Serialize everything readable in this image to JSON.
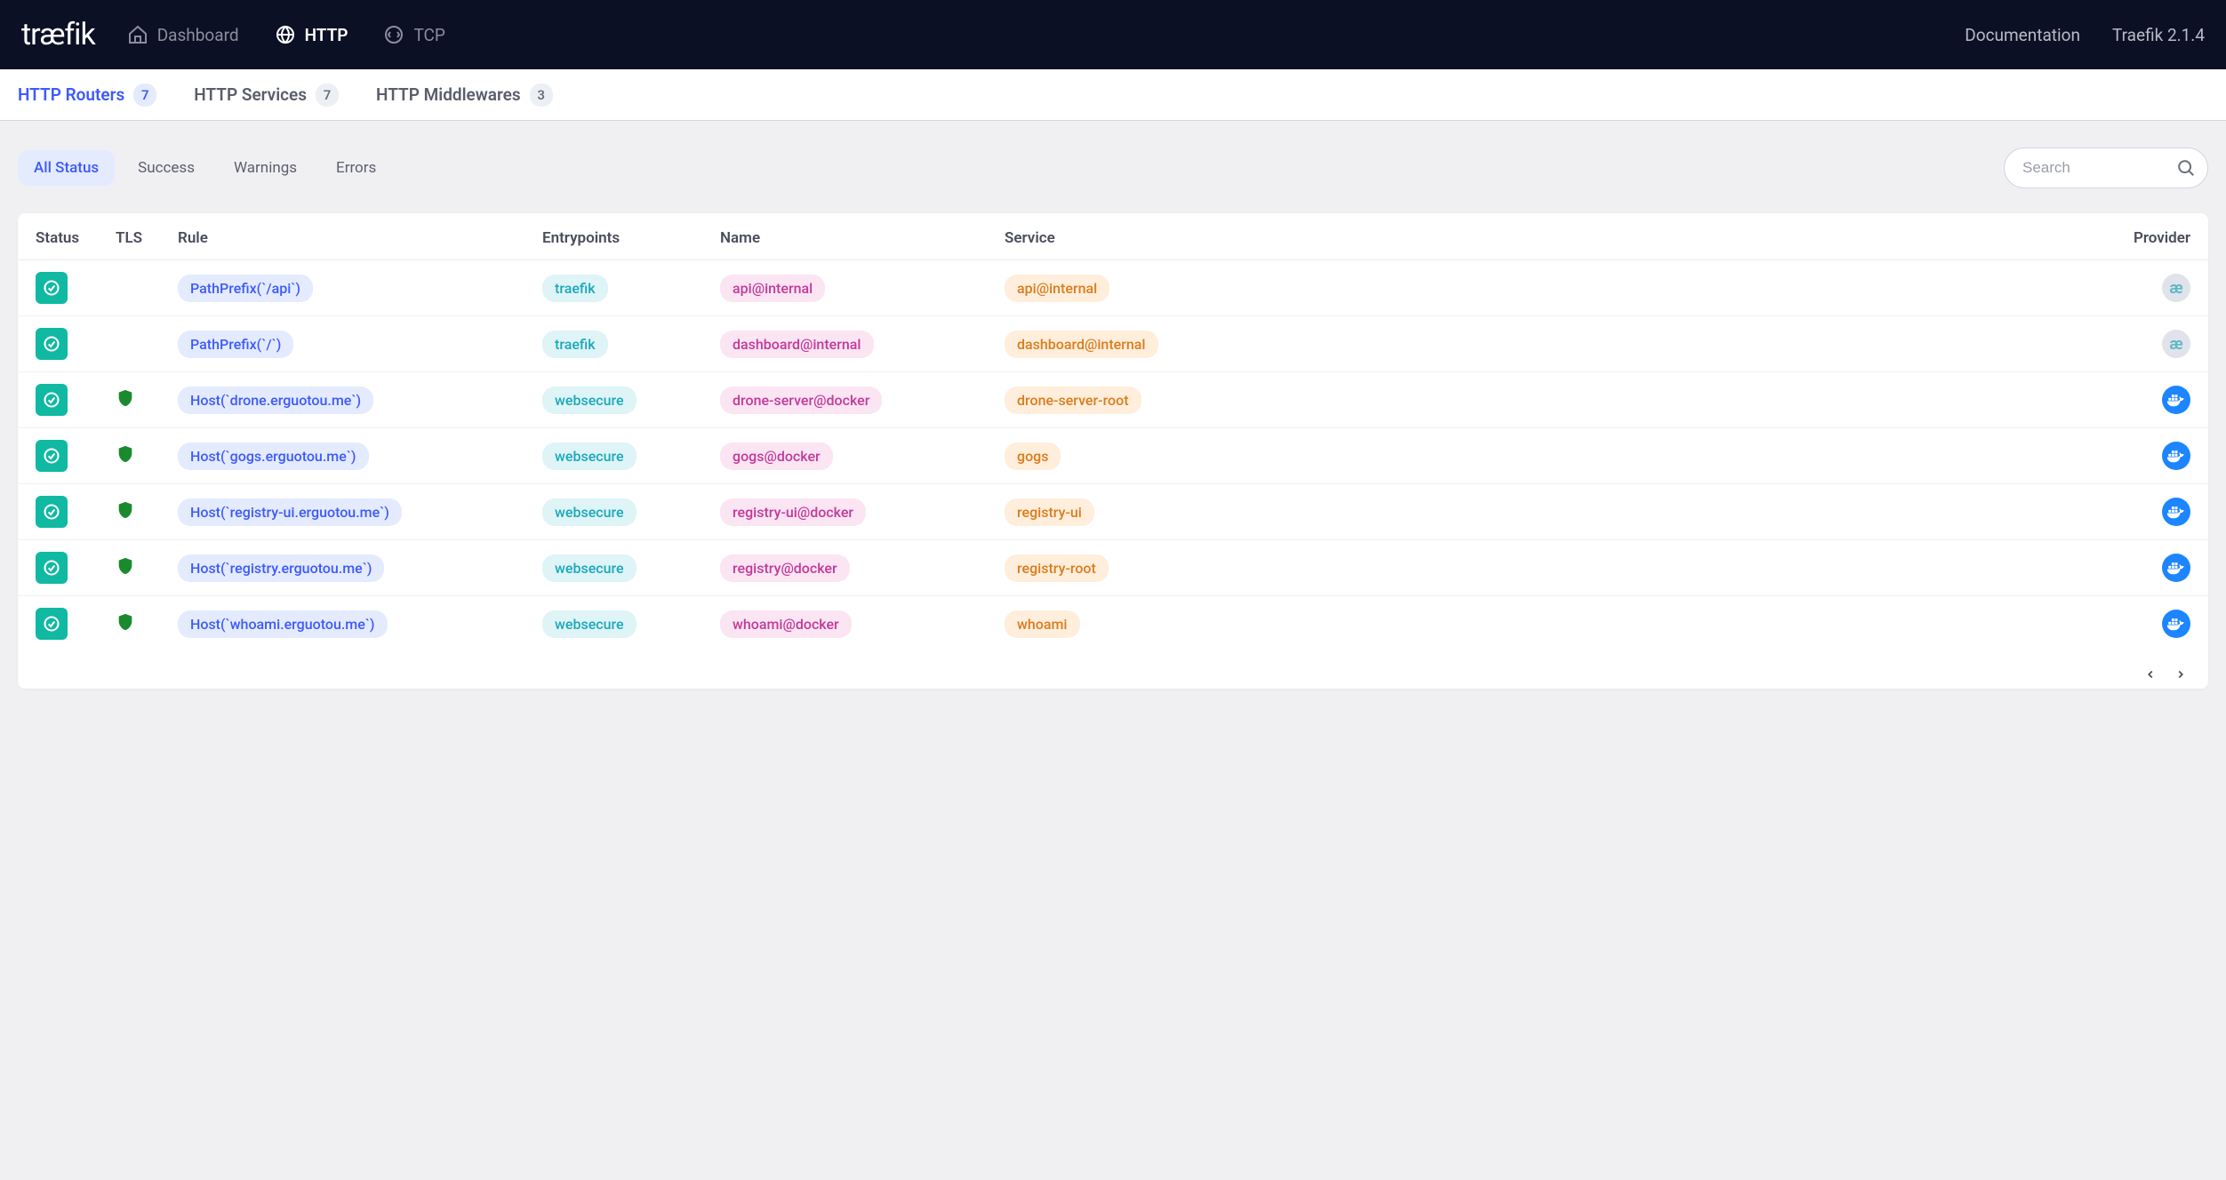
{
  "brand": "træfik",
  "topnav": {
    "items": [
      {
        "key": "dashboard",
        "label": "Dashboard",
        "active": false,
        "icon": "home"
      },
      {
        "key": "http",
        "label": "HTTP",
        "active": true,
        "icon": "globe"
      },
      {
        "key": "tcp",
        "label": "TCP",
        "active": false,
        "icon": "circle-arrows"
      }
    ],
    "right": {
      "docs": "Documentation",
      "version": "Traefik 2.1.4"
    }
  },
  "subtabs": [
    {
      "label": "HTTP Routers",
      "count": "7",
      "active": true
    },
    {
      "label": "HTTP Services",
      "count": "7",
      "active": false
    },
    {
      "label": "HTTP Middlewares",
      "count": "3",
      "active": false
    }
  ],
  "filters": {
    "statuses": [
      {
        "label": "All Status",
        "active": true
      },
      {
        "label": "Success",
        "active": false
      },
      {
        "label": "Warnings",
        "active": false
      },
      {
        "label": "Errors",
        "active": false
      }
    ],
    "search_placeholder": "Search"
  },
  "table": {
    "columns": {
      "status": "Status",
      "tls": "TLS",
      "rule": "Rule",
      "entrypoints": "Entrypoints",
      "name": "Name",
      "service": "Service",
      "provider": "Provider"
    },
    "rows": [
      {
        "status": "ok",
        "tls": false,
        "rule": "PathPrefix(`/api`)",
        "entrypoints": "traefik",
        "name": "api@internal",
        "service": "api@internal",
        "provider": "internal"
      },
      {
        "status": "ok",
        "tls": false,
        "rule": "PathPrefix(`/`)",
        "entrypoints": "traefik",
        "name": "dashboard@internal",
        "service": "dashboard@internal",
        "provider": "internal"
      },
      {
        "status": "ok",
        "tls": true,
        "rule": "Host(`drone.erguotou.me`)",
        "entrypoints": "websecure",
        "name": "drone-server@docker",
        "service": "drone-server-root",
        "provider": "docker"
      },
      {
        "status": "ok",
        "tls": true,
        "rule": "Host(`gogs.erguotou.me`)",
        "entrypoints": "websecure",
        "name": "gogs@docker",
        "service": "gogs",
        "provider": "docker"
      },
      {
        "status": "ok",
        "tls": true,
        "rule": "Host(`registry-ui.erguotou.me`)",
        "entrypoints": "websecure",
        "name": "registry-ui@docker",
        "service": "registry-ui",
        "provider": "docker"
      },
      {
        "status": "ok",
        "tls": true,
        "rule": "Host(`registry.erguotou.me`)",
        "entrypoints": "websecure",
        "name": "registry@docker",
        "service": "registry-root",
        "provider": "docker"
      },
      {
        "status": "ok",
        "tls": true,
        "rule": "Host(`whoami.erguotou.me`)",
        "entrypoints": "websecure",
        "name": "whoami@docker",
        "service": "whoami",
        "provider": "docker"
      }
    ]
  }
}
